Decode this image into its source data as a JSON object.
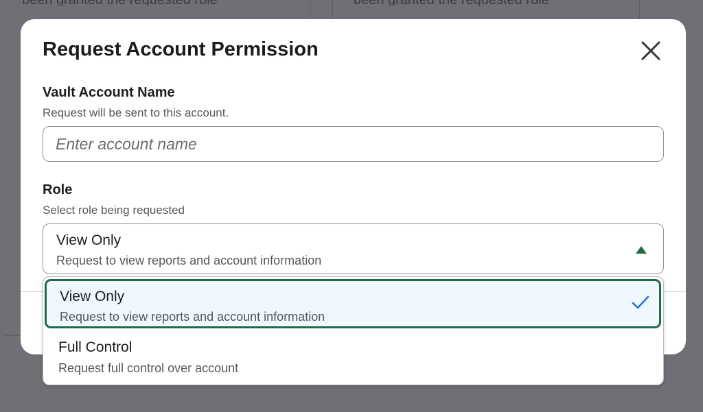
{
  "background": {
    "card_left_text": "been granted the requested role",
    "card_right_text": "been granted the requested role"
  },
  "modal": {
    "title": "Request Account Permission",
    "close_icon": "close-icon"
  },
  "account_field": {
    "label": "Vault Account Name",
    "help": "Request will be sent to this account.",
    "value": "",
    "placeholder": "Enter account name"
  },
  "role_field": {
    "label": "Role",
    "help": "Select role being requested",
    "selected_title": "View Only",
    "selected_desc": "Request to view reports and account information",
    "caret_icon": "caret-up-icon"
  },
  "role_options": [
    {
      "title": "View Only",
      "desc": "Request to view reports and account information",
      "selected": true
    },
    {
      "title": "Full Control",
      "desc": "Request full control over account",
      "selected": false
    }
  ],
  "colors": {
    "accent_green": "#1f6b45",
    "check_blue": "#2a6fd1",
    "selected_bg": "#eef8fd",
    "overlay": "#6e7075"
  }
}
